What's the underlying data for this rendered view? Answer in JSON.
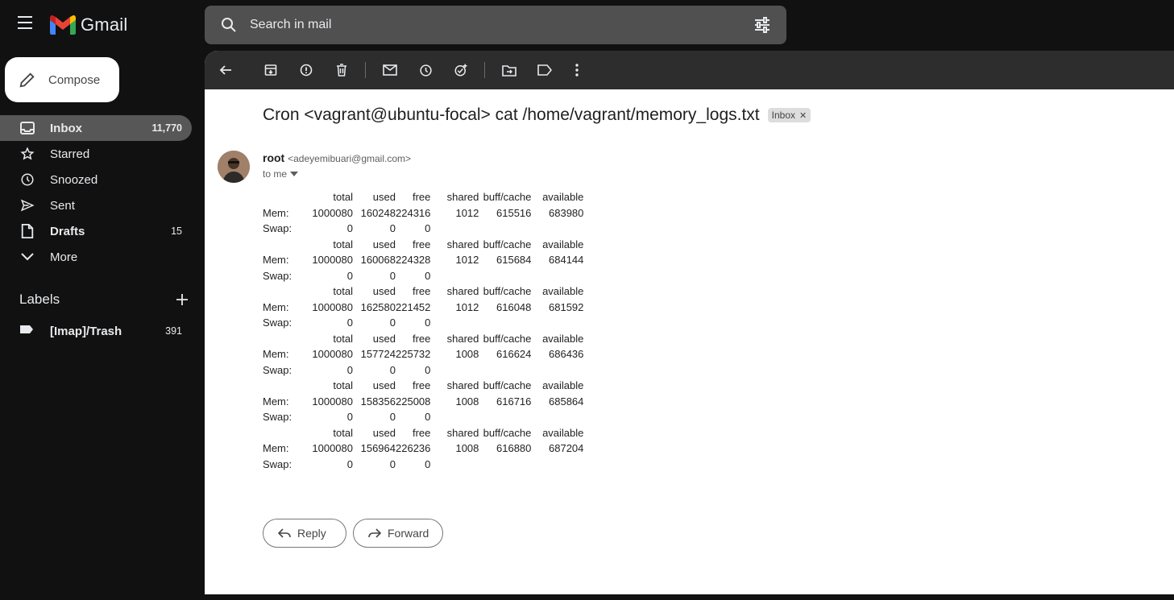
{
  "app": {
    "name": "Gmail"
  },
  "search": {
    "placeholder": "Search in mail"
  },
  "compose": {
    "label": "Compose"
  },
  "nav": [
    {
      "label": "Inbox",
      "count": "11,770",
      "icon": "inbox-icon"
    },
    {
      "label": "Starred",
      "count": "",
      "icon": "star-icon"
    },
    {
      "label": "Snoozed",
      "count": "",
      "icon": "clock-icon"
    },
    {
      "label": "Sent",
      "count": "",
      "icon": "send-icon"
    },
    {
      "label": "Drafts",
      "count": "15",
      "icon": "draft-icon"
    },
    {
      "label": "More",
      "count": "",
      "icon": "chevron-down-icon"
    }
  ],
  "labels": {
    "title": "Labels",
    "items": [
      {
        "label": "[Imap]/Trash",
        "count": "391"
      }
    ]
  },
  "email": {
    "subject": "Cron <vagrant@ubuntu-focal> cat /home/vagrant/memory_logs.txt",
    "chip": "Inbox",
    "sender_name": "root",
    "sender_email": "<adeyemibuari@gmail.com>",
    "to": "to me",
    "log_header": [
      "total",
      "used",
      "free",
      "shared",
      "buff/cache",
      "available"
    ],
    "log_blocks": [
      {
        "mem": [
          "Mem:",
          "1000080",
          "160248",
          "224316",
          "1012",
          "615516",
          "683980"
        ],
        "swap": [
          "Swap:",
          "0",
          "0",
          "0"
        ]
      },
      {
        "mem": [
          "Mem:",
          "1000080",
          "160068",
          "224328",
          "1012",
          "615684",
          "684144"
        ],
        "swap": [
          "Swap:",
          "0",
          "0",
          "0"
        ]
      },
      {
        "mem": [
          "Mem:",
          "1000080",
          "162580",
          "221452",
          "1012",
          "616048",
          "681592"
        ],
        "swap": [
          "Swap:",
          "0",
          "0",
          "0"
        ]
      },
      {
        "mem": [
          "Mem:",
          "1000080",
          "157724",
          "225732",
          "1008",
          "616624",
          "686436"
        ],
        "swap": [
          "Swap:",
          "0",
          "0",
          "0"
        ]
      },
      {
        "mem": [
          "Mem:",
          "1000080",
          "158356",
          "225008",
          "1008",
          "616716",
          "685864"
        ],
        "swap": [
          "Swap:",
          "0",
          "0",
          "0"
        ]
      },
      {
        "mem": [
          "Mem:",
          "1000080",
          "156964",
          "226236",
          "1008",
          "616880",
          "687204"
        ],
        "swap": [
          "Swap:",
          "0",
          "0",
          "0"
        ]
      }
    ]
  },
  "actions": {
    "reply": "Reply",
    "forward": "Forward"
  },
  "colors": {
    "background": "#111111",
    "search_bg": "#505050",
    "active_nav": "#575757",
    "toolbar": "#2d2d2d"
  }
}
